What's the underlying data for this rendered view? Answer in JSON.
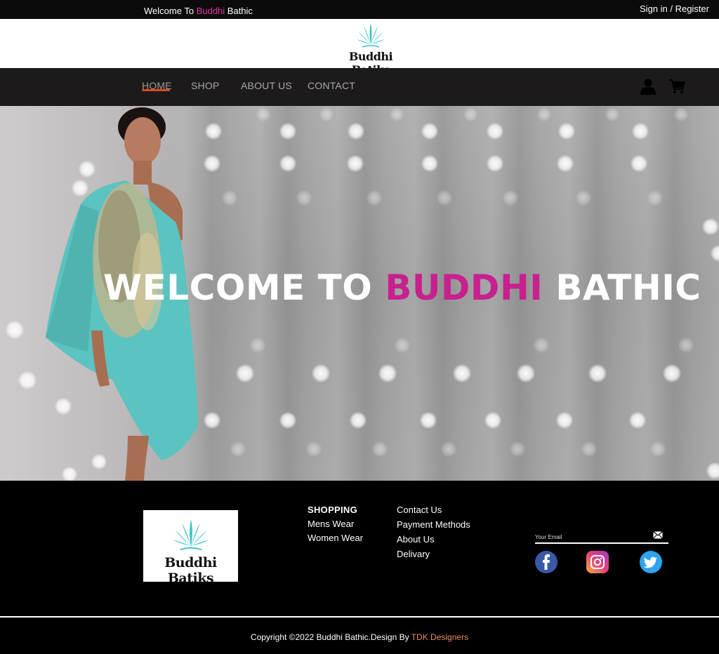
{
  "topbar": {
    "welcome_prefix": "Welcome To",
    "welcome_accent": "Buddhi",
    "welcome_suffix": "Bathic",
    "signin": "Sign in / Register"
  },
  "brand": {
    "name": "Buddhi Batiks"
  },
  "nav": {
    "items": [
      {
        "label": "HOME"
      },
      {
        "label": "SHOP"
      },
      {
        "label": "ABOUT US"
      },
      {
        "label": "CONTACT"
      }
    ],
    "active": "HOME",
    "user_icon": "user-icon",
    "cart_icon": "cart-icon"
  },
  "hero": {
    "title_prefix": "WELCOME TO",
    "title_accent": "BUDDHI",
    "title_suffix": "BATHIC"
  },
  "footer": {
    "shopping": {
      "heading": "SHOPPING",
      "links": [
        "Mens Wear",
        "Women Wear"
      ]
    },
    "info_links": [
      "Contact Us",
      "Payment Methods",
      "About Us",
      "Delivary"
    ],
    "email_placeholder": "Your Email",
    "social": [
      "facebook-icon",
      "instagram-icon",
      "twitter-icon"
    ],
    "copyright_prefix": "Copyright",
    "copyright_middle": "2022 Buddhi Bathic.Design By",
    "copyright_accent": "TDK Designers"
  },
  "colors": {
    "accent_pink": "#c8208e",
    "nav_underline": "#e2451f",
    "nav_bg": "#1c1a1b",
    "logo_teal": "#3fc3c9"
  }
}
